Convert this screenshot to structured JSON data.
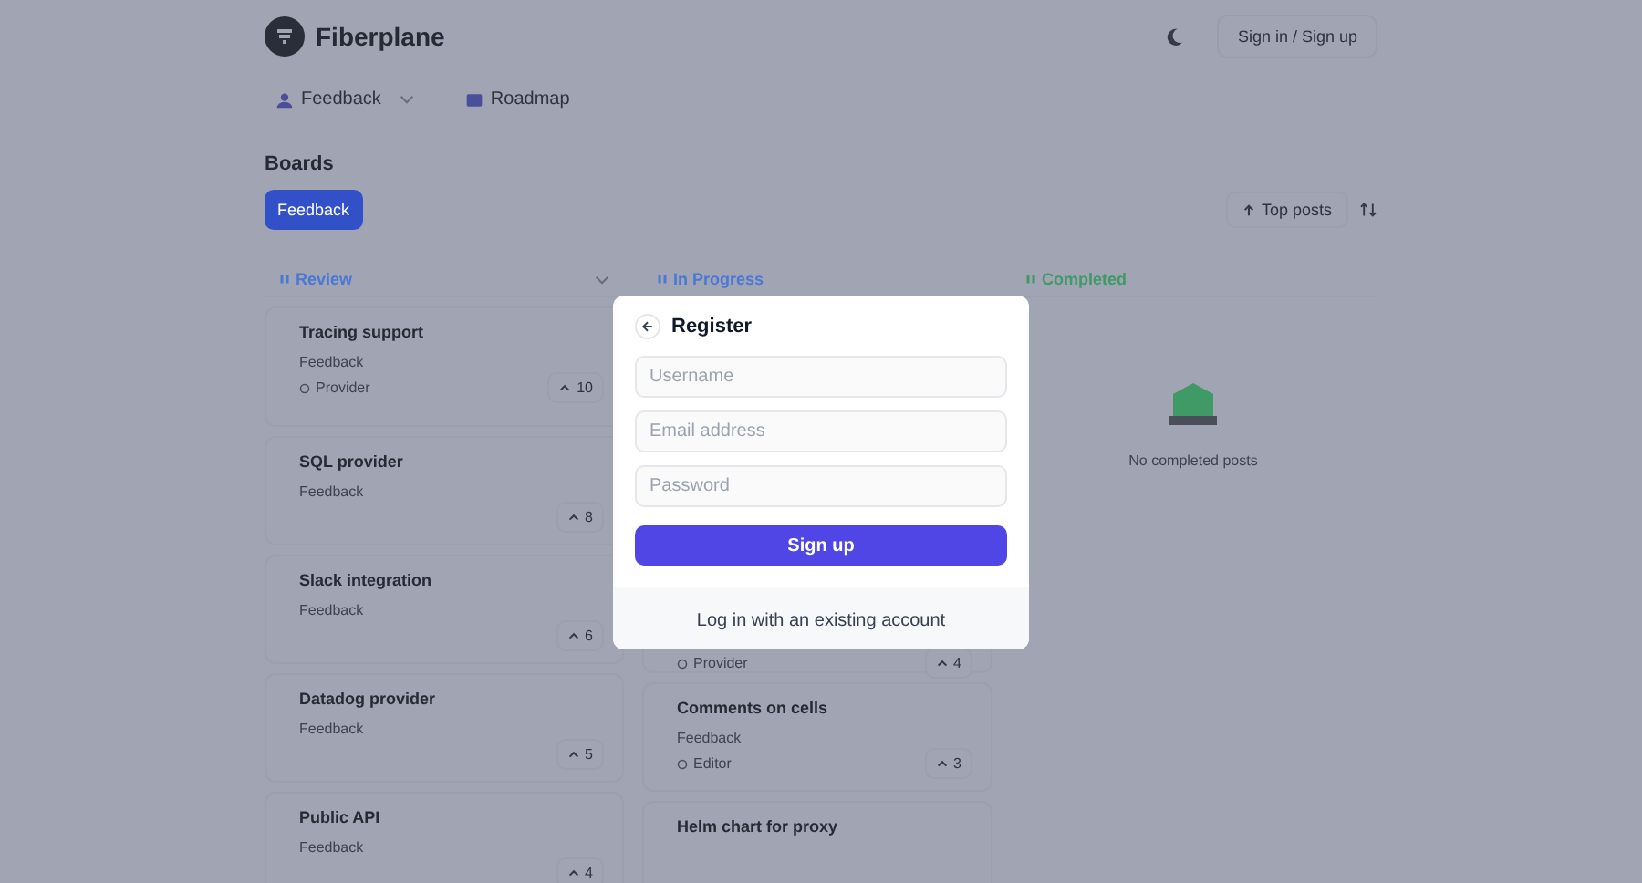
{
  "header": {
    "brand": "Fiberplane",
    "auth_button": "Sign in / Sign up"
  },
  "nav": [
    {
      "label": "Feedback",
      "kind": "dropdown"
    },
    {
      "label": "Roadmap",
      "kind": "link"
    }
  ],
  "boards": {
    "title": "Boards",
    "items": [
      {
        "label": "Feedback",
        "selected": true
      }
    ],
    "sort": "Top posts"
  },
  "columns": [
    {
      "title": "Review",
      "color": "#4a78d6",
      "collapsible": true,
      "posts": [
        {
          "title": "Tracing support",
          "board": "Feedback",
          "tag": "Provider",
          "votes": "10"
        },
        {
          "title": "SQL provider",
          "board": "Feedback",
          "votes": "8"
        },
        {
          "title": "Slack integration",
          "board": "Feedback",
          "votes": "6"
        },
        {
          "title": "Datadog provider",
          "board": "Feedback",
          "votes": "5"
        },
        {
          "title": "Public API",
          "board": "Feedback",
          "votes": "4"
        }
      ]
    },
    {
      "title": "In Progress",
      "color": "#4a78d6",
      "collapsible": false,
      "posts": [
        {
          "tag": "Provider",
          "votes": "4"
        },
        {
          "title": "Comments on cells",
          "board": "Feedback",
          "tag": "Editor",
          "votes": "3"
        },
        {
          "title": "Helm chart for proxy"
        }
      ]
    },
    {
      "title": "Completed",
      "color": "#3f9a66",
      "collapsible": false,
      "empty_text": "No completed posts"
    }
  ],
  "dialog": {
    "title": "Register",
    "fields": [
      {
        "placeholder": "Username"
      },
      {
        "placeholder": "Email address"
      },
      {
        "placeholder": "Password"
      }
    ],
    "submit": "Sign up",
    "footer_link": "Log in with an existing account"
  }
}
